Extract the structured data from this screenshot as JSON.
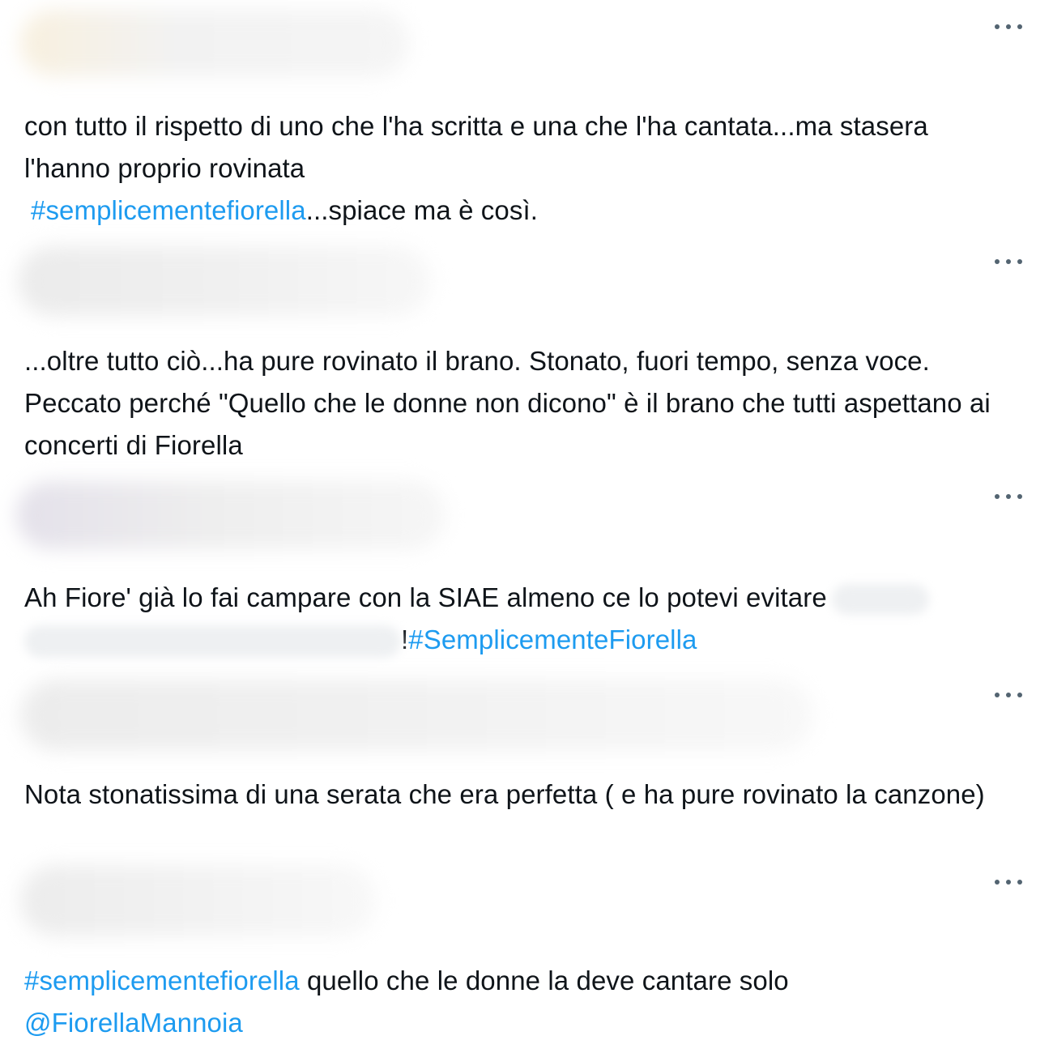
{
  "feed": {
    "accent_color": "#1d9bf0",
    "text_color": "#0f1419",
    "more_icon": "ellipsis-icon",
    "tweets": [
      {
        "segments": [
          {
            "type": "text",
            "value": "con tutto il rispetto di uno che l'ha scritta e una che l'ha cantata...ma stasera l'hanno proprio rovinata"
          },
          {
            "type": "hashtag",
            "value": "#semplicementefiorella"
          },
          {
            "type": "text",
            "value": "...spiace ma è così."
          }
        ]
      },
      {
        "segments": [
          {
            "type": "text",
            "value": "...oltre tutto ciò...ha pure rovinato il brano. Stonato, fuori tempo, senza voce. Peccato perché \"Quello che le donne non dicono\" è il brano che tutti aspettano ai concerti di Fiorella"
          }
        ]
      },
      {
        "segments": [
          {
            "type": "text",
            "value": "Ah Fiore' già lo fai campare con la SIAE almeno ce lo potevi evitare"
          },
          {
            "type": "text",
            "value": "!"
          },
          {
            "type": "hashtag",
            "value": "#SemplicementeFiorella"
          }
        ]
      },
      {
        "segments": [
          {
            "type": "text",
            "value": "Nota stonatissima di una serata che era perfetta ( e ha pure rovinato la canzone)"
          }
        ]
      },
      {
        "segments": [
          {
            "type": "hashtag",
            "value": "#semplicementefiorella"
          },
          {
            "type": "text",
            "value": " quello che le donne la deve cantare solo "
          },
          {
            "type": "mention",
            "value": "@FiorellaMannoia"
          }
        ]
      }
    ]
  }
}
